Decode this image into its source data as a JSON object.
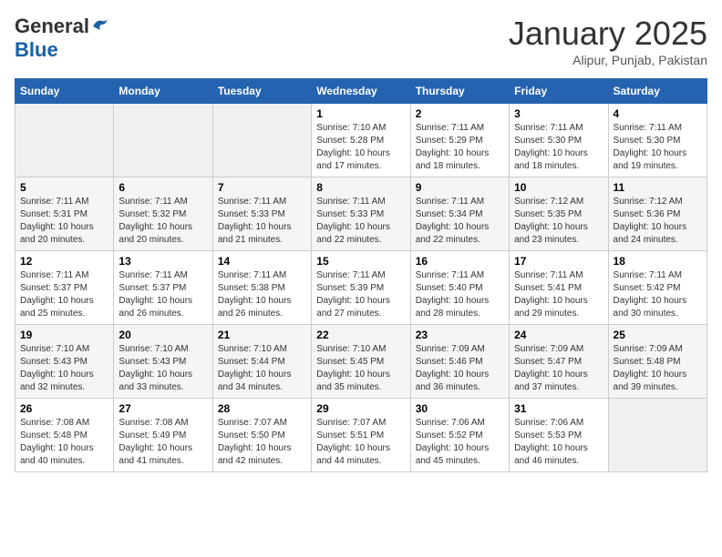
{
  "header": {
    "logo_general": "General",
    "logo_blue": "Blue",
    "month_title": "January 2025",
    "location": "Alipur, Punjab, Pakistan"
  },
  "days_of_week": [
    "Sunday",
    "Monday",
    "Tuesday",
    "Wednesday",
    "Thursday",
    "Friday",
    "Saturday"
  ],
  "weeks": [
    [
      {
        "day": "",
        "info": ""
      },
      {
        "day": "",
        "info": ""
      },
      {
        "day": "",
        "info": ""
      },
      {
        "day": "1",
        "info": "Sunrise: 7:10 AM\nSunset: 5:28 PM\nDaylight: 10 hours\nand 17 minutes."
      },
      {
        "day": "2",
        "info": "Sunrise: 7:11 AM\nSunset: 5:29 PM\nDaylight: 10 hours\nand 18 minutes."
      },
      {
        "day": "3",
        "info": "Sunrise: 7:11 AM\nSunset: 5:30 PM\nDaylight: 10 hours\nand 18 minutes."
      },
      {
        "day": "4",
        "info": "Sunrise: 7:11 AM\nSunset: 5:30 PM\nDaylight: 10 hours\nand 19 minutes."
      }
    ],
    [
      {
        "day": "5",
        "info": "Sunrise: 7:11 AM\nSunset: 5:31 PM\nDaylight: 10 hours\nand 20 minutes."
      },
      {
        "day": "6",
        "info": "Sunrise: 7:11 AM\nSunset: 5:32 PM\nDaylight: 10 hours\nand 20 minutes."
      },
      {
        "day": "7",
        "info": "Sunrise: 7:11 AM\nSunset: 5:33 PM\nDaylight: 10 hours\nand 21 minutes."
      },
      {
        "day": "8",
        "info": "Sunrise: 7:11 AM\nSunset: 5:33 PM\nDaylight: 10 hours\nand 22 minutes."
      },
      {
        "day": "9",
        "info": "Sunrise: 7:11 AM\nSunset: 5:34 PM\nDaylight: 10 hours\nand 22 minutes."
      },
      {
        "day": "10",
        "info": "Sunrise: 7:12 AM\nSunset: 5:35 PM\nDaylight: 10 hours\nand 23 minutes."
      },
      {
        "day": "11",
        "info": "Sunrise: 7:12 AM\nSunset: 5:36 PM\nDaylight: 10 hours\nand 24 minutes."
      }
    ],
    [
      {
        "day": "12",
        "info": "Sunrise: 7:11 AM\nSunset: 5:37 PM\nDaylight: 10 hours\nand 25 minutes."
      },
      {
        "day": "13",
        "info": "Sunrise: 7:11 AM\nSunset: 5:37 PM\nDaylight: 10 hours\nand 26 minutes."
      },
      {
        "day": "14",
        "info": "Sunrise: 7:11 AM\nSunset: 5:38 PM\nDaylight: 10 hours\nand 26 minutes."
      },
      {
        "day": "15",
        "info": "Sunrise: 7:11 AM\nSunset: 5:39 PM\nDaylight: 10 hours\nand 27 minutes."
      },
      {
        "day": "16",
        "info": "Sunrise: 7:11 AM\nSunset: 5:40 PM\nDaylight: 10 hours\nand 28 minutes."
      },
      {
        "day": "17",
        "info": "Sunrise: 7:11 AM\nSunset: 5:41 PM\nDaylight: 10 hours\nand 29 minutes."
      },
      {
        "day": "18",
        "info": "Sunrise: 7:11 AM\nSunset: 5:42 PM\nDaylight: 10 hours\nand 30 minutes."
      }
    ],
    [
      {
        "day": "19",
        "info": "Sunrise: 7:10 AM\nSunset: 5:43 PM\nDaylight: 10 hours\nand 32 minutes."
      },
      {
        "day": "20",
        "info": "Sunrise: 7:10 AM\nSunset: 5:43 PM\nDaylight: 10 hours\nand 33 minutes."
      },
      {
        "day": "21",
        "info": "Sunrise: 7:10 AM\nSunset: 5:44 PM\nDaylight: 10 hours\nand 34 minutes."
      },
      {
        "day": "22",
        "info": "Sunrise: 7:10 AM\nSunset: 5:45 PM\nDaylight: 10 hours\nand 35 minutes."
      },
      {
        "day": "23",
        "info": "Sunrise: 7:09 AM\nSunset: 5:46 PM\nDaylight: 10 hours\nand 36 minutes."
      },
      {
        "day": "24",
        "info": "Sunrise: 7:09 AM\nSunset: 5:47 PM\nDaylight: 10 hours\nand 37 minutes."
      },
      {
        "day": "25",
        "info": "Sunrise: 7:09 AM\nSunset: 5:48 PM\nDaylight: 10 hours\nand 39 minutes."
      }
    ],
    [
      {
        "day": "26",
        "info": "Sunrise: 7:08 AM\nSunset: 5:48 PM\nDaylight: 10 hours\nand 40 minutes."
      },
      {
        "day": "27",
        "info": "Sunrise: 7:08 AM\nSunset: 5:49 PM\nDaylight: 10 hours\nand 41 minutes."
      },
      {
        "day": "28",
        "info": "Sunrise: 7:07 AM\nSunset: 5:50 PM\nDaylight: 10 hours\nand 42 minutes."
      },
      {
        "day": "29",
        "info": "Sunrise: 7:07 AM\nSunset: 5:51 PM\nDaylight: 10 hours\nand 44 minutes."
      },
      {
        "day": "30",
        "info": "Sunrise: 7:06 AM\nSunset: 5:52 PM\nDaylight: 10 hours\nand 45 minutes."
      },
      {
        "day": "31",
        "info": "Sunrise: 7:06 AM\nSunset: 5:53 PM\nDaylight: 10 hours\nand 46 minutes."
      },
      {
        "day": "",
        "info": ""
      }
    ]
  ]
}
